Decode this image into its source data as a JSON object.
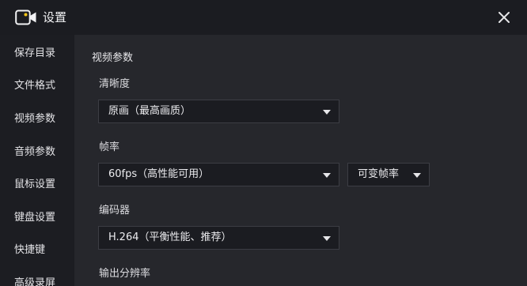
{
  "window": {
    "title": "设置"
  },
  "sidebar": {
    "items": [
      {
        "label": "保存目录"
      },
      {
        "label": "文件格式"
      },
      {
        "label": "视频参数"
      },
      {
        "label": "音频参数"
      },
      {
        "label": "鼠标设置"
      },
      {
        "label": "键盘设置"
      },
      {
        "label": "快捷键"
      },
      {
        "label": "高级录屏"
      }
    ]
  },
  "main": {
    "section_title": "视频参数",
    "clarity": {
      "label": "清晰度",
      "value": "原画（最高画质）"
    },
    "framerate": {
      "label": "帧率",
      "value": "60fps（高性能可用）",
      "mode_value": "可变帧率"
    },
    "encoder": {
      "label": "编码器",
      "value": "H.264（平衡性能、推荐）"
    },
    "resolution": {
      "label": "输出分辨率"
    }
  },
  "icons": {
    "app": "video-camera-icon",
    "close": "close-icon",
    "dropdown": "chevron-down-icon"
  },
  "colors": {
    "titlebar_bg": "#1b1c21",
    "sidebar_bg": "#1c1d22",
    "content_bg": "#26272c",
    "field_bg": "#1b1c21",
    "field_border": "#3c3d44",
    "text": "#e8e8ea",
    "app_icon_accent": "#f5c518"
  }
}
